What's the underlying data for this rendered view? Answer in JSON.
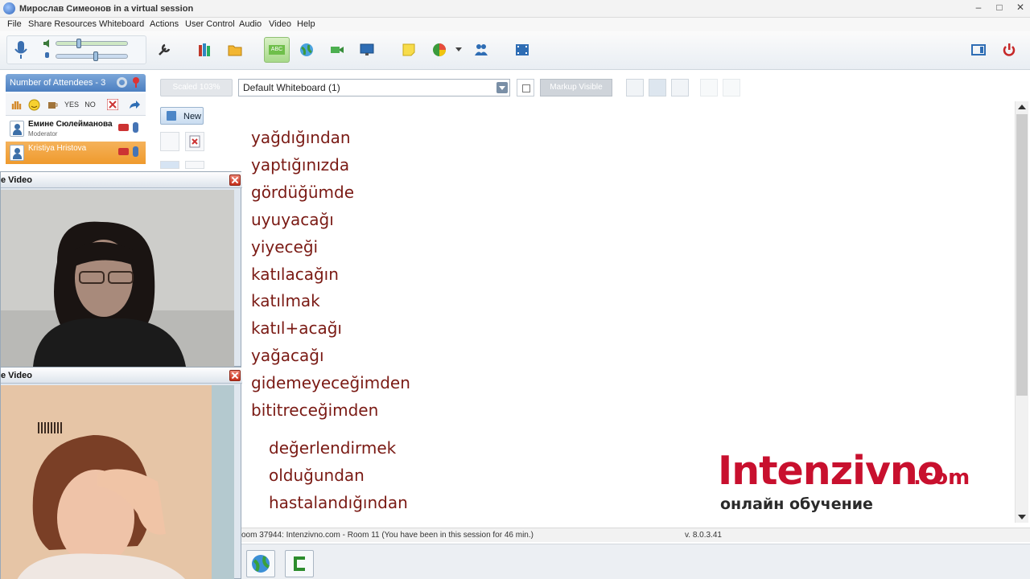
{
  "window": {
    "title": "Мирослав Симеонов in a virtual session",
    "min": "–",
    "max": "□",
    "close": "✕"
  },
  "menu": [
    "File",
    "Share Resources",
    "Whiteboard",
    "Actions",
    "User Control",
    "Audio",
    "Video",
    "Help"
  ],
  "toolbar": {
    "mic_volume": 0.3,
    "speaker_volume": 0.55,
    "active_tool": "whiteboard-text",
    "whiteboard_text_label": "ABC"
  },
  "attendees": {
    "header": "Number of Attendees - 3",
    "tools": [
      "YES",
      "NO"
    ],
    "list": [
      {
        "name": "Емине Сюлейманова",
        "role": "Moderator"
      },
      {
        "name": "Kristiya Hristova",
        "role": ""
      }
    ]
  },
  "whiteboard": {
    "scaled": "Scaled 103%",
    "selected": "Default Whiteboard (1)",
    "markup": "Markup Visible",
    "new_label": "New",
    "words": [
      "yağdığından",
      "yaptığınızda",
      "gördüğümde",
      "uyuyacağı",
      "yiyeceği",
      "katılacağın",
      "katılmak",
      "katıl+acağı",
      "yağacağı",
      "gidemeyeceğimden",
      "bititreceğimden"
    ],
    "words_indented": [
      "değerlendirmek",
      "olduğundan",
      "hastalandığından"
    ]
  },
  "brand": {
    "main": "Intenzivno",
    "domain": ".com",
    "sub": "онлайн обучение"
  },
  "videos": [
    {
      "title": "e Video"
    },
    {
      "title": "e Video"
    }
  ],
  "status": {
    "message": "oom 37944: Intenzivno.com - Room 11 (You have been in this session for 46 min.)",
    "version": "v. 8.0.3.41"
  },
  "colors": {
    "word": "#7a1a14",
    "brand_red": "#c8102e",
    "header_blue": "#4c7fc1",
    "active_green": "#a7d98a"
  }
}
